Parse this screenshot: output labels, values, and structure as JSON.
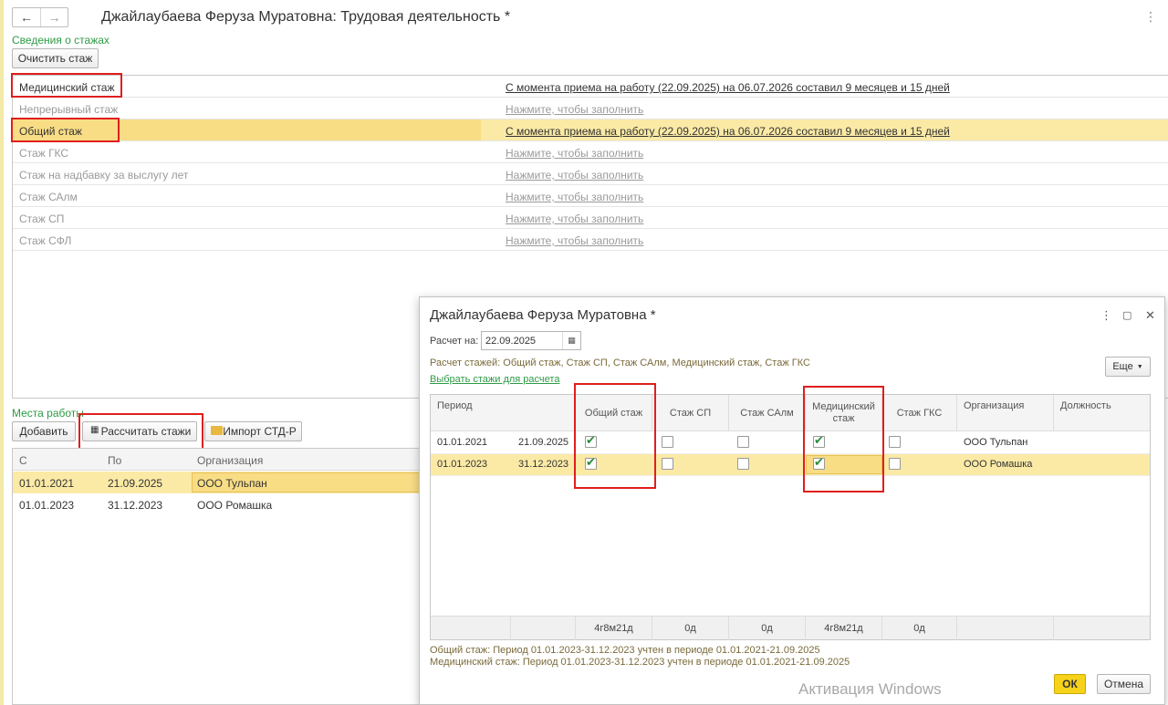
{
  "form": {
    "title": "Джайлаубаева Феруза Муратовна: Трудовая деятельность *",
    "nav_back": "←",
    "nav_forward": "→",
    "more_menu": "⋮"
  },
  "stazh_section": {
    "label": "Сведения о стажах",
    "clear_button": "Очистить стаж",
    "rows": [
      {
        "name": "Медицинский стаж",
        "value": "С момента приема на работу (22.09.2025) на 06.07.2026 составил 9 месяцев и 15 дней"
      },
      {
        "name": "Непрерывный стаж",
        "value": "Нажмите, чтобы заполнить"
      },
      {
        "name": "Общий стаж",
        "value": "С момента приема на работу (22.09.2025) на 06.07.2026 составил 9 месяцев и 15 дней"
      },
      {
        "name": "Стаж ГКС",
        "value": "Нажмите, чтобы заполнить"
      },
      {
        "name": "Стаж на надбавку за выслугу лет",
        "value": "Нажмите, чтобы заполнить"
      },
      {
        "name": "Стаж САлм",
        "value": "Нажмите, чтобы заполнить"
      },
      {
        "name": "Стаж СП",
        "value": "Нажмите, чтобы заполнить"
      },
      {
        "name": "Стаж СФЛ",
        "value": "Нажмите, чтобы заполнить"
      }
    ]
  },
  "work_section": {
    "label": "Места работы",
    "add_button": "Добавить",
    "calc_button": "Рассчитать стажи",
    "import_button": "Импорт СТД-Р",
    "columns": [
      "С",
      "По",
      "Организация"
    ],
    "rows": [
      {
        "from": "01.01.2021",
        "to": "21.09.2025",
        "org": "ООО Тульпан"
      },
      {
        "from": "01.01.2023",
        "to": "31.12.2023",
        "org": "ООО Ромашка"
      }
    ]
  },
  "dialog": {
    "title": "Джайлаубаева Феруза Муратовна *",
    "calc_on_label": "Расчет на:",
    "calc_on_value": "22.09.2025",
    "calc_list": "Расчет стажей: Общий стаж, Стаж СП, Стаж САлм, Медицинский стаж, Стаж ГКС",
    "select_link": "Выбрать стажи для расчета",
    "more_button": "Еще",
    "columns": [
      "Период",
      "Общий стаж",
      "Стаж СП",
      "Стаж САлм",
      "Медицинский стаж",
      "Стаж ГКС",
      "Организация",
      "Должность"
    ],
    "rows": [
      {
        "from": "01.01.2021",
        "to": "21.09.2025",
        "general": true,
        "sp": false,
        "salm": false,
        "medical": true,
        "gks": false,
        "org": "ООО Тульпан",
        "position": ""
      },
      {
        "from": "01.01.2023",
        "to": "31.12.2023",
        "general": true,
        "sp": false,
        "salm": false,
        "medical": true,
        "gks": false,
        "org": "ООО Ромашка",
        "position": ""
      }
    ],
    "totals": {
      "general": "4г8м21д",
      "sp": "0д",
      "salm": "0д",
      "medical": "4г8м21д",
      "gks": "0д"
    },
    "note_general": "Общий стаж: Период 01.01.2023-31.12.2023 учтен в периоде 01.01.2021-21.09.2025",
    "note_medical": "Медицинский стаж: Период 01.01.2023-31.12.2023 учтен в периоде 01.01.2021-21.09.2025",
    "ok_button": "ОК",
    "cancel_button": "Отмена"
  },
  "watermark": "Активация Windows",
  "colors": {
    "accent_green": "#2d9b45",
    "highlight": "#fbeaa6",
    "selected_cell": "#f8dd85",
    "ok_yellow": "#f7d21a",
    "annotation_red": "#e01e1e"
  }
}
